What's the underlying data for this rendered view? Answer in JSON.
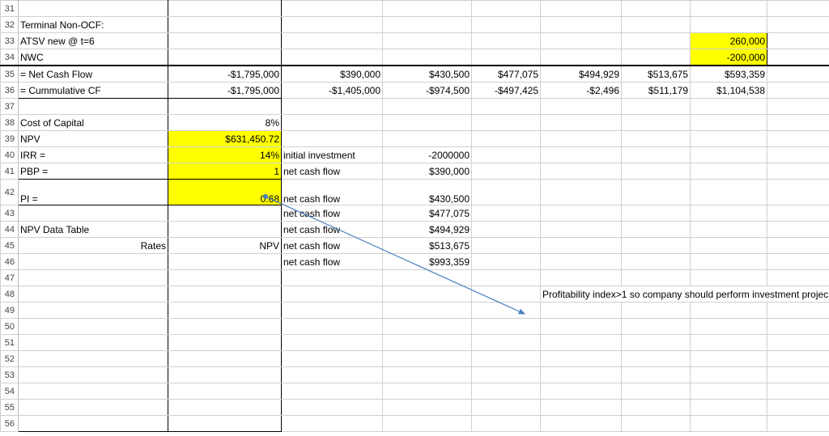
{
  "rows": {
    "r31": {
      "num": "31"
    },
    "r32": {
      "num": "32",
      "b": "Terminal Non-OCF:"
    },
    "r33": {
      "num": "33",
      "b": "ATSV new @ t=6",
      "i": "260,000"
    },
    "r34": {
      "num": "34",
      "b": "NWC",
      "i": "-200,000"
    },
    "r35": {
      "num": "35",
      "b": "= Net Cash Flow",
      "c": "-$1,795,000",
      "d": "$390,000",
      "e": "$430,500",
      "f": "$477,075",
      "g": "$494,929",
      "h": "$513,675",
      "i": "$593,359"
    },
    "r36": {
      "num": "36",
      "b": "= Cummulative CF",
      "c": "-$1,795,000",
      "d": "-$1,405,000",
      "e": "-$974,500",
      "f": "-$497,425",
      "g": "-$2,496",
      "h": "$511,179",
      "i": "$1,104,538"
    },
    "r37": {
      "num": "37"
    },
    "r38": {
      "num": "38",
      "b": "Cost of Capital",
      "c": "8%"
    },
    "r39": {
      "num": "39",
      "b": "NPV",
      "c": "$631,450.72"
    },
    "r40": {
      "num": "40",
      "b": "IRR =",
      "c": "14%",
      "d": "initial investment",
      "e": "-2000000"
    },
    "r41": {
      "num": "41",
      "b": "PBP =",
      "c": "1",
      "d": "net cash flow",
      "e": "$390,000"
    },
    "r42": {
      "num": "42",
      "b": "PI =",
      "c": "0.68",
      "d": "net cash flow",
      "e": "$430,500"
    },
    "r43": {
      "num": "43",
      "d": "net cash flow",
      "e": "$477,075"
    },
    "r44": {
      "num": "44",
      "b": "NPV Data Table",
      "d": "net cash flow",
      "e": "$494,929"
    },
    "r45": {
      "num": "45",
      "b": "Rates",
      "c": "NPV",
      "d": "net cash flow",
      "e": "$513,675"
    },
    "r46": {
      "num": "46",
      "d": "net cash flow",
      "e": "$993,359"
    },
    "r47": {
      "num": "47"
    },
    "r48": {
      "num": "48",
      "note": "Profitability index>1 so company should perform investment projec"
    },
    "r49": {
      "num": "49"
    },
    "r50": {
      "num": "50"
    },
    "r51": {
      "num": "51"
    },
    "r52": {
      "num": "52"
    },
    "r53": {
      "num": "53"
    },
    "r54": {
      "num": "54"
    },
    "r55": {
      "num": "55"
    },
    "r56": {
      "num": "56"
    }
  }
}
